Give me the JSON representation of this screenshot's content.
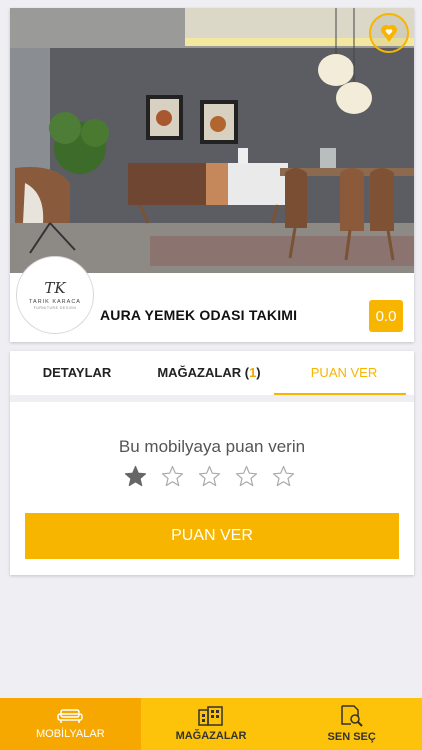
{
  "product": {
    "title": "AURA YEMEK ODASI TAKIMI",
    "rating": "0.0",
    "brand": {
      "mark": "TK",
      "name": "TARIK KARACA",
      "sub": "FURNITURE DESIGN"
    }
  },
  "icons": {
    "favorite": "heart-location-icon"
  },
  "tabs": [
    {
      "label": "DETAYLAR",
      "active": false
    },
    {
      "label": "MAĞAZALAR (",
      "count": "1",
      "suffix": ")",
      "active": false
    },
    {
      "label": "PUAN VER",
      "active": true
    }
  ],
  "rating_section": {
    "prompt": "Bu mobilyaya puan verin",
    "stars_total": 5,
    "stars_selected": 1,
    "submit_label": "PUAN VER"
  },
  "bottom_nav": [
    {
      "label": "MOBİLYALAR",
      "icon": "sofa-icon",
      "active": true
    },
    {
      "label": "MAĞAZALAR",
      "icon": "building-icon",
      "active": false
    },
    {
      "label": "SEN SEÇ",
      "icon": "search-document-icon",
      "active": false
    }
  ],
  "colors": {
    "accent": "#f7b500",
    "nav": "#fdc30a",
    "background": "#eeeef3"
  }
}
